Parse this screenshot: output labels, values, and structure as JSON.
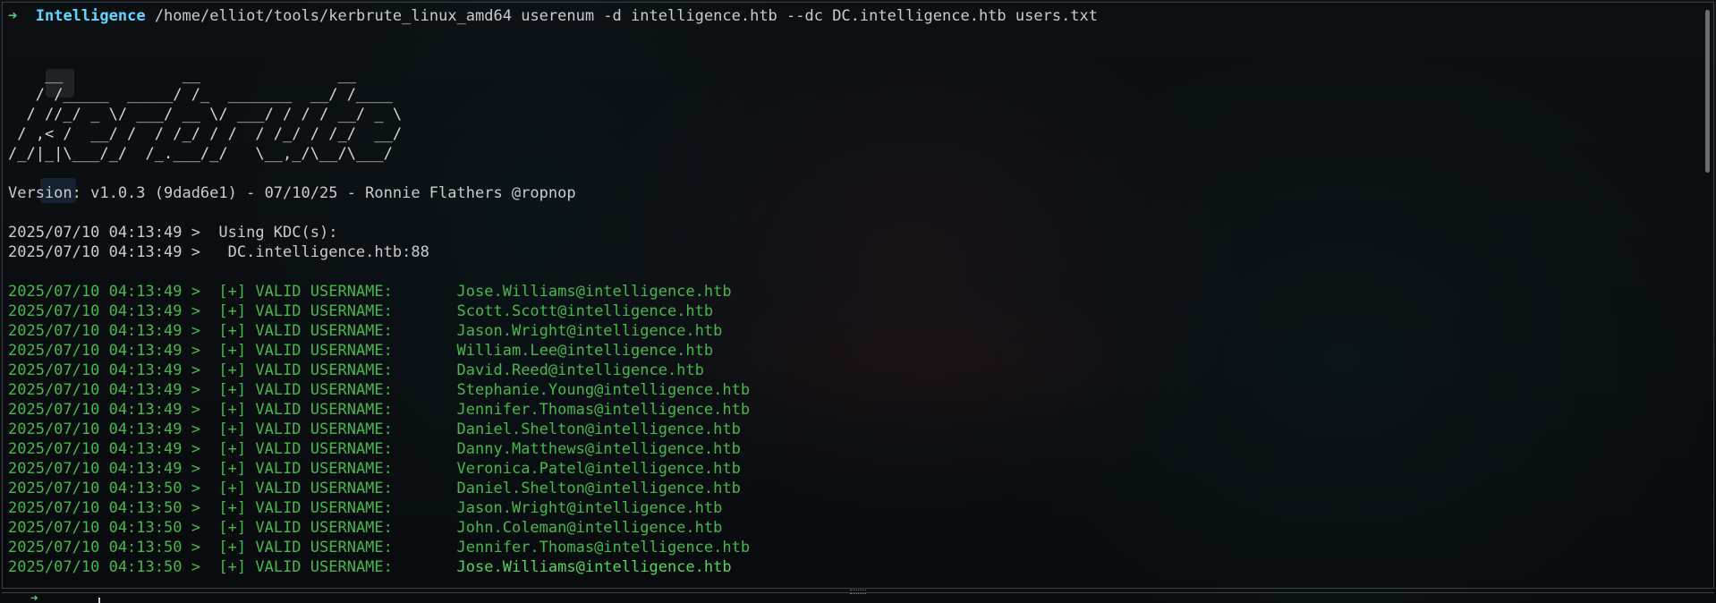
{
  "prompt": {
    "arrow": "➜",
    "directory": "Intelligence",
    "command": "/home/elliot/tools/kerbrute_linux_amd64 userenum -d intelligence.htb --dc DC.intelligence.htb users.txt"
  },
  "banner": {
    "ascii_art": "    __             __               __     \n   / /_____  _____/ /_  _______  __/ /____ \n  / //_/ _ \\/ ___/ __ \\/ ___/ / / / __/ _ \\\n / ,< /  __/ /  / /_/ / /  / /_/ / /_/  __/\n/_/|_|\\___/_/  /_.___/_/   \\__,_/\\__/\\___/ ",
    "version_line": "Version: v1.0.3 (9dad6e1) - 07/10/25 - Ronnie Flathers @ropnop"
  },
  "kdc_lines": [
    "2025/07/10 04:13:49 >  Using KDC(s):",
    "2025/07/10 04:13:49 >  \tDC.intelligence.htb:88"
  ],
  "results": [
    {
      "time": "2025/07/10 04:13:49 >",
      "tag": "[+] VALID USERNAME:",
      "user": "Jose.Williams@intelligence.htb"
    },
    {
      "time": "2025/07/10 04:13:49 >",
      "tag": "[+] VALID USERNAME:",
      "user": "Scott.Scott@intelligence.htb"
    },
    {
      "time": "2025/07/10 04:13:49 >",
      "tag": "[+] VALID USERNAME:",
      "user": "Jason.Wright@intelligence.htb"
    },
    {
      "time": "2025/07/10 04:13:49 >",
      "tag": "[+] VALID USERNAME:",
      "user": "William.Lee@intelligence.htb"
    },
    {
      "time": "2025/07/10 04:13:49 >",
      "tag": "[+] VALID USERNAME:",
      "user": "David.Reed@intelligence.htb"
    },
    {
      "time": "2025/07/10 04:13:49 >",
      "tag": "[+] VALID USERNAME:",
      "user": "Stephanie.Young@intelligence.htb"
    },
    {
      "time": "2025/07/10 04:13:49 >",
      "tag": "[+] VALID USERNAME:",
      "user": "Jennifer.Thomas@intelligence.htb"
    },
    {
      "time": "2025/07/10 04:13:49 >",
      "tag": "[+] VALID USERNAME:",
      "user": "Daniel.Shelton@intelligence.htb"
    },
    {
      "time": "2025/07/10 04:13:49 >",
      "tag": "[+] VALID USERNAME:",
      "user": "Danny.Matthews@intelligence.htb"
    },
    {
      "time": "2025/07/10 04:13:49 >",
      "tag": "[+] VALID USERNAME:",
      "user": "Veronica.Patel@intelligence.htb"
    },
    {
      "time": "2025/07/10 04:13:50 >",
      "tag": "[+] VALID USERNAME:",
      "user": "Daniel.Shelton@intelligence.htb"
    },
    {
      "time": "2025/07/10 04:13:50 >",
      "tag": "[+] VALID USERNAME:",
      "user": "Jason.Wright@intelligence.htb"
    },
    {
      "time": "2025/07/10 04:13:50 >",
      "tag": "[+] VALID USERNAME:",
      "user": "John.Coleman@intelligence.htb"
    },
    {
      "time": "2025/07/10 04:13:50 >",
      "tag": "[+] VALID USERNAME:",
      "user": "Jennifer.Thomas@intelligence.htb"
    },
    {
      "time": "2025/07/10 04:13:50 >",
      "tag": "[+] VALID USERNAME:",
      "user": "Jose.Williams@intelligence.htb"
    }
  ],
  "colors": {
    "prompt_arrow": "#4fd17f",
    "prompt_dir": "#5fd7ff",
    "success_text": "#45b84a",
    "default_text": "#c9ccd0"
  }
}
